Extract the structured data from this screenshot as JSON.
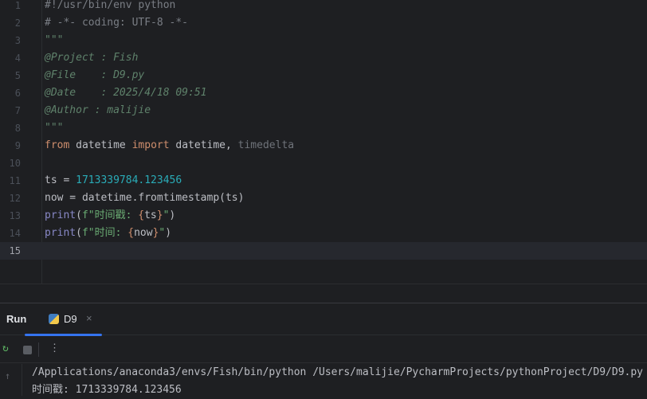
{
  "editor": {
    "current_line": 15,
    "lines": [
      {
        "n": "1",
        "tokens": [
          {
            "t": "#!/usr/bin/env python",
            "c": "com"
          }
        ]
      },
      {
        "n": "2",
        "tokens": [
          {
            "t": "# -*- coding: UTF-8 -*-",
            "c": "com"
          }
        ]
      },
      {
        "n": "3",
        "tokens": [
          {
            "t": "\"\"\"",
            "c": "doc"
          }
        ]
      },
      {
        "n": "4",
        "tokens": [
          {
            "t": "@Project : Fish",
            "c": "doc"
          }
        ]
      },
      {
        "n": "5",
        "tokens": [
          {
            "t": "@File    : D9.py",
            "c": "doc"
          }
        ]
      },
      {
        "n": "6",
        "tokens": [
          {
            "t": "@Date    : 2025/4/18 09:51",
            "c": "doc"
          }
        ]
      },
      {
        "n": "7",
        "tokens": [
          {
            "t": "@Author : malijie",
            "c": "doc"
          }
        ]
      },
      {
        "n": "8",
        "tokens": [
          {
            "t": "\"\"\"",
            "c": "doc"
          }
        ]
      },
      {
        "n": "9",
        "tokens": [
          {
            "t": "from",
            "c": "kw"
          },
          {
            "t": " datetime ",
            "c": "id"
          },
          {
            "t": "import",
            "c": "kw"
          },
          {
            "t": " datetime, ",
            "c": "id"
          },
          {
            "t": "timedelta",
            "c": "unused"
          }
        ]
      },
      {
        "n": "10",
        "tokens": []
      },
      {
        "n": "11",
        "tokens": [
          {
            "t": "ts = ",
            "c": "id"
          },
          {
            "t": "1713339784.123456",
            "c": "num"
          }
        ]
      },
      {
        "n": "12",
        "tokens": [
          {
            "t": "now = datetime.fromtimestamp(ts)",
            "c": "id"
          }
        ]
      },
      {
        "n": "13",
        "tokens": [
          {
            "t": "print",
            "c": "bi"
          },
          {
            "t": "(",
            "c": "id"
          },
          {
            "t": "f\"时间戳: ",
            "c": "str"
          },
          {
            "t": "{",
            "c": "br"
          },
          {
            "t": "ts",
            "c": "id"
          },
          {
            "t": "}",
            "c": "br"
          },
          {
            "t": "\"",
            "c": "str"
          },
          {
            "t": ")",
            "c": "id"
          }
        ]
      },
      {
        "n": "14",
        "tokens": [
          {
            "t": "print",
            "c": "bi"
          },
          {
            "t": "(",
            "c": "id"
          },
          {
            "t": "f\"时间: ",
            "c": "str"
          },
          {
            "t": "{",
            "c": "br"
          },
          {
            "t": "now",
            "c": "id"
          },
          {
            "t": "}",
            "c": "br"
          },
          {
            "t": "\"",
            "c": "str"
          },
          {
            "t": ")",
            "c": "id"
          }
        ]
      },
      {
        "n": "15",
        "tokens": []
      }
    ]
  },
  "run_panel": {
    "title": "Run",
    "tab_label": "D9",
    "tab_close": "×",
    "rerun_icon": "↻",
    "more_icon": "⋮",
    "scroll_up_icon": "↑",
    "console_lines": [
      "/Applications/anaconda3/envs/Fish/bin/python /Users/malijie/PycharmProjects/pythonProject/D9/D9.py",
      "时间戳: 1713339784.123456"
    ]
  }
}
